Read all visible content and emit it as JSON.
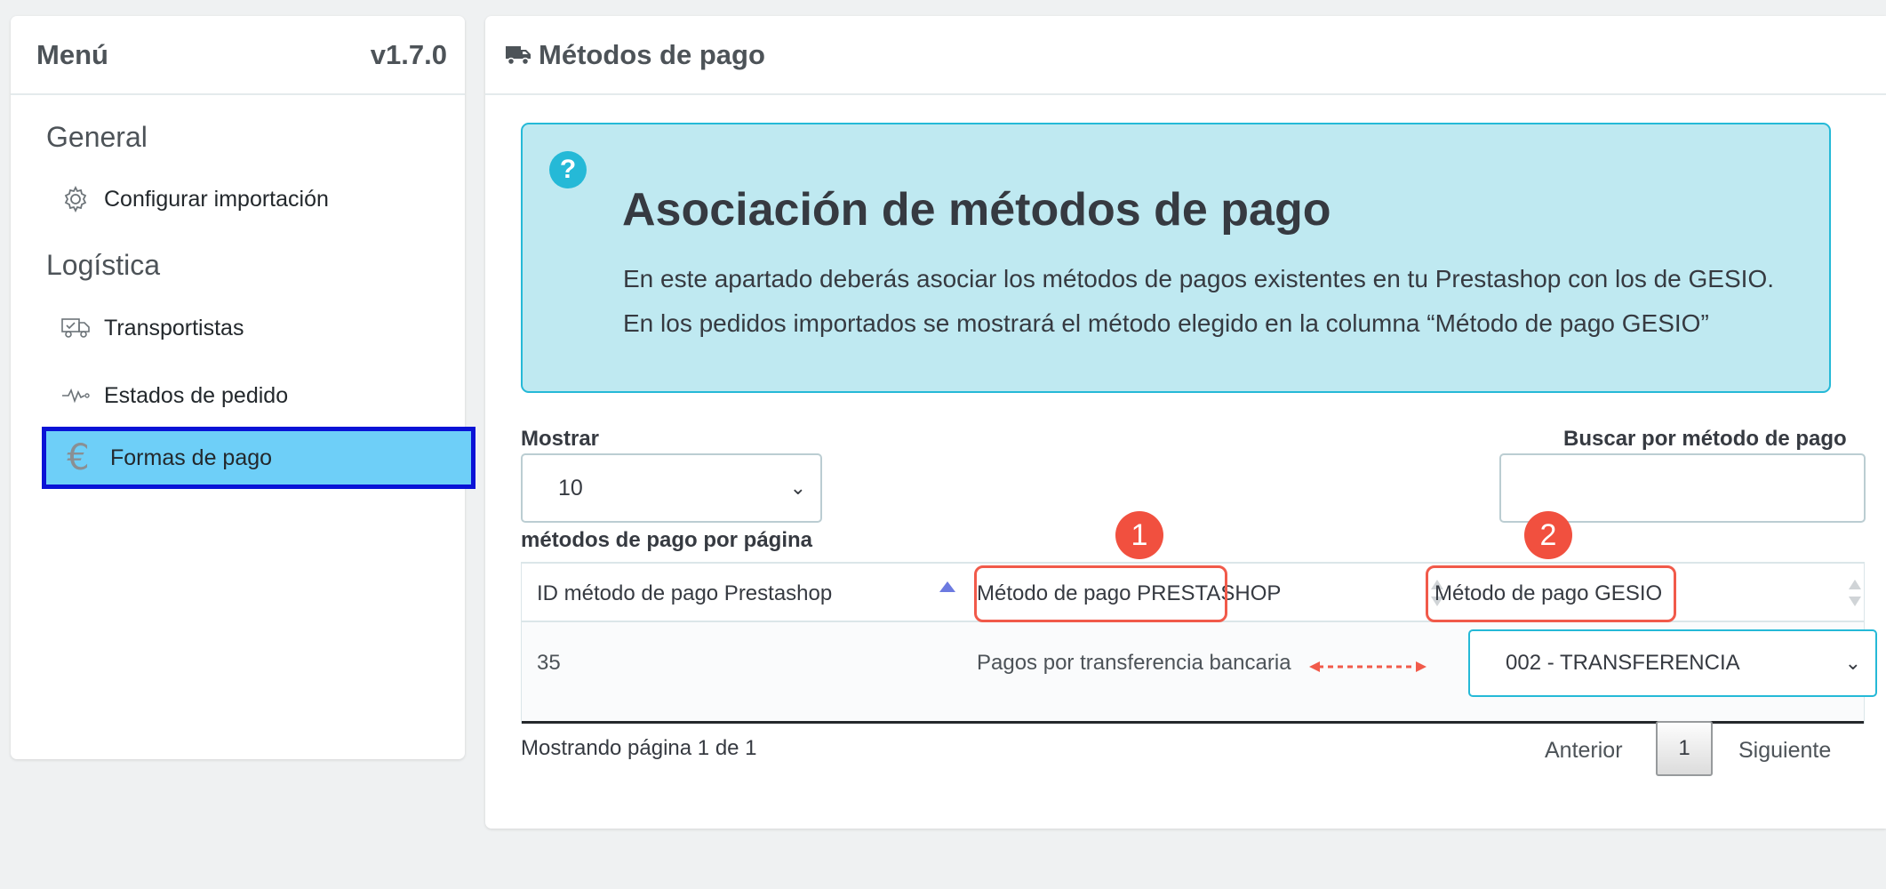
{
  "sidebar": {
    "title": "Menú",
    "version": "v1.7.0",
    "sections": [
      {
        "label": "General",
        "items": [
          {
            "label": "Configurar importación",
            "icon": "gear-icon"
          }
        ]
      },
      {
        "label": "Logística",
        "items": [
          {
            "label": "Transportistas",
            "icon": "truck-icon"
          },
          {
            "label": "Estados de pedido",
            "icon": "activity-icon"
          },
          {
            "label": "Formas de pago",
            "icon": "euro-icon",
            "active": true
          }
        ]
      }
    ],
    "active_color": "#6ecff8",
    "active_border": "#0a13d6",
    "euro_symbol": "€"
  },
  "main": {
    "title": "Métodos de pago",
    "title_icon": "truck-icon",
    "info": {
      "icon": "question-icon",
      "icon_text": "?",
      "title": "Asociación de métodos de pago",
      "line1": "En este apartado deberás asociar los métodos de pagos existentes en tu Prestashop con los de GESIO.",
      "line2": "En los pedidos importados se mostrará el método elegido en la columna “Método de pago GESIO”",
      "background": "#bfe9f1",
      "border": "#25b9d7"
    },
    "show_label": "Mostrar",
    "page_size": "10",
    "per_page_label": "métodos de pago por página",
    "search_label": "Buscar por método de pago",
    "search_value": "",
    "table": {
      "columns": [
        "ID método de pago Prestashop",
        "Método de pago PRESTASHOP",
        "Método de pago GESIO"
      ],
      "rows": [
        {
          "id": "35",
          "prestashop": "Pagos por transferencia bancaria",
          "gesio": "002 - TRANSFERENCIA"
        }
      ]
    },
    "callouts": [
      "1",
      "2"
    ],
    "callout_color": "#f15a4a",
    "pagination": {
      "info": "Mostrando página 1 de 1",
      "prev": "Anterior",
      "current": "1",
      "next": "Siguiente"
    }
  }
}
